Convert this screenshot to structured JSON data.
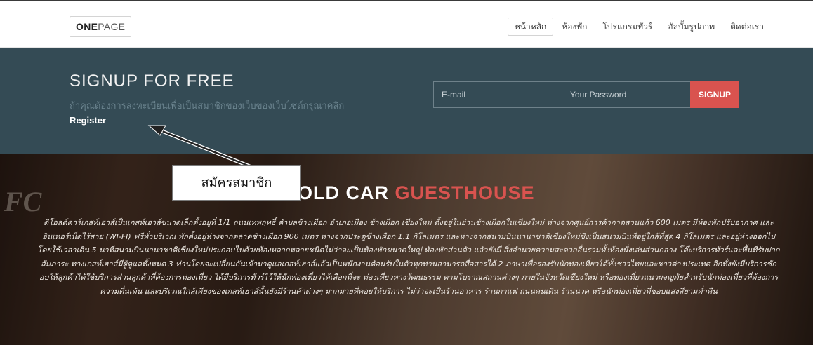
{
  "navbar": {
    "brand_bold": "ONE",
    "brand_light": "PAGE",
    "items": [
      {
        "label": "หน้าหลัก",
        "active": true
      },
      {
        "label": "ห้องพัก",
        "active": false
      },
      {
        "label": "โปรแกรมทัวร์",
        "active": false
      },
      {
        "label": "อัลบั้มรูปภาพ",
        "active": false
      },
      {
        "label": "ติดต่อเรา",
        "active": false
      }
    ]
  },
  "signup": {
    "title": "SIGNUP FOR FREE",
    "subtitle": "ถ้าคุณต้องการลงทะเบียนเพื่อเป็นสมาชิกของเว็บของเว็บไซต์กรุณาคลิก",
    "register_link": "Register",
    "email_placeholder": "E-mail",
    "password_placeholder": "Your Password",
    "button_label": "SIGNUP",
    "accent_color": "#d9534f"
  },
  "hero": {
    "title_white": "E OLD CAR",
    "title_accent": "GUESTHOUSE",
    "bg_sign": "FC",
    "description": "ดิโอลด์คาร์เกสท์เฮาส์เป็นเกสท์เฮาส์ขนาดเล็กตั้งอยู่ที่ 1/1 ถนนเทพฤทธิ์ ตำบลช้างเผือก อำเภอเมือง ช้างเผือก เชียงใหม่ ตั้งอยู่ในย่านช้างเผือกในเชียงใหม่ ห่างจากศูนย์การค้ากาดสวนแก้ว 600 เมตร มีห้องพักปรับอากาศ และอินเทอร์เน็ตไร้สาย (WI-FI) ฟรีทั่วบริเวณ พักตั้งอยู่ห่างจากตลาดช้างเผือก 900 เมตร ห่างจากประตูช้างเผือก 1.1 กิโลเมตร และห่างจากสนามบินนานาชาติเชียงใหม่ซึ่งเป็นสนามบินที่อยู่ใกล้ที่สุด 4 กิโลเมตร และอยู่ห่างออกไปโดยใช้เวลาเดิน 5 นาทีสนามบินนานาชาติเชียงใหม่ประกอบไปด้วยห้องหลากหลายชนิดไม่ว่าจะเป็นห้องพักขนาดใหญ่ ห้องพักส่วนตัว แล้วยังมี สิ่งอำนวยความสะดวกอื่นรวมทั้งห้องนั่งเล่นส่วนกลาง โต๊ะบริการทัวร์และพื้นที่รับฝากสัมภาระ ทางเกสท์เฮาส์มีผู้ดูแลทั้งหมด 3 ท่านโดยจะเปลี่ยนกันเข้ามาดูแลเกสท์เฮาส์แล้วเป็นพนักงานต้อนรับในตัวทุกท่านสามารถสื่อสารได้ 2 ภาษาเพื่อรองรับนักท่องเที่ยวได้ทั้งชาวไทยและชาวต่างประเทศ อีกทั้งยังมีบริการชักอบให้ลูกค้าได้ใช้บริการส่วนลูกค้าที่ต้องการท่องเที่ยว ได้มีบริการทัวร์ไว้ให้นักท่องเที่ยวได้เลือกที่จะ ท่องเที่ยวทางวัฒนธรรม ตามโบราณสถานต่างๆ ภายในจังหวัดเชียงใหม่ หรือท่องเที่ยวแนวผจญภัยสำหรับนักท่องเที่ยวที่ต้องการความตื่นเต้น และบริเวณใกล้เคียงของเกสท์เฮาส์นั้นยังมีร้านค้าต่างๆ มากมายที่คอยให้บริการ ไม่ว่าจะเป็นร้านอาหาร ร้านกาแฟ ถนนคนเดิน ร้านนวด หรือนักท่องเที่ยวที่ชอบแสงสียามค่ำคืน"
  },
  "annotation": {
    "label": "สมัครสมาชิก"
  }
}
